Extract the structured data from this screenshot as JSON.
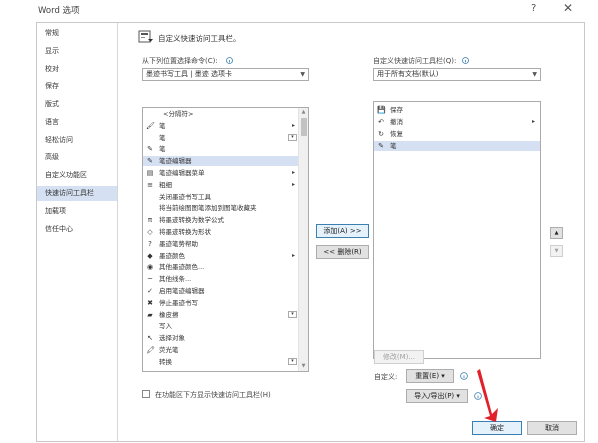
{
  "window": {
    "title": "Word 选项",
    "help_glyph": "?",
    "close_glyph": "✕"
  },
  "sidebar": {
    "items": [
      {
        "label": "常规"
      },
      {
        "label": "显示"
      },
      {
        "label": "校对"
      },
      {
        "label": "保存"
      },
      {
        "label": "版式"
      },
      {
        "label": "语言"
      },
      {
        "label": "轻松访问"
      },
      {
        "label": "高级"
      },
      {
        "label": "自定义功能区"
      },
      {
        "label": "快速访问工具栏",
        "active": true
      },
      {
        "label": "加载项"
      },
      {
        "label": "信任中心"
      }
    ]
  },
  "header": {
    "title": "自定义快速访问工具栏。",
    "icon": "quick-access-toolbar-icon"
  },
  "left_panel": {
    "label": "从下列位置选择命令(C):",
    "dropdown_value": "墨迹书写工具 | 墨迹 选项卡",
    "items": [
      {
        "label": "<分隔符>",
        "icon": "",
        "submenu": false,
        "mini": false
      },
      {
        "label": "笔",
        "icon": "🖌",
        "submenu": true,
        "mini": false
      },
      {
        "label": "笔",
        "icon": "",
        "submenu": false,
        "mini": true
      },
      {
        "label": "笔",
        "icon": "✎",
        "submenu": false,
        "mini": false
      },
      {
        "label": "笔迹编辑器",
        "icon": "✎",
        "submenu": false,
        "mini": false,
        "selected": true
      },
      {
        "label": "笔迹编辑器菜单",
        "icon": "▤",
        "submenu": true,
        "mini": false
      },
      {
        "label": "粗细",
        "icon": "≡",
        "submenu": true,
        "mini": false
      },
      {
        "label": "关闭墨迹书写工具",
        "icon": "",
        "submenu": false,
        "mini": false
      },
      {
        "label": "将当前绘图图笔添加到图笔收藏夹",
        "icon": "",
        "submenu": false,
        "mini": false
      },
      {
        "label": "将墨迹转换为数学公式",
        "icon": "π",
        "submenu": false,
        "mini": false
      },
      {
        "label": "将墨迹转换为形状",
        "icon": "◇",
        "submenu": false,
        "mini": false
      },
      {
        "label": "墨迹笔势帮助",
        "icon": "?",
        "submenu": false,
        "mini": false
      },
      {
        "label": "墨迹颜色",
        "icon": "◆",
        "submenu": true,
        "mini": false
      },
      {
        "label": "其他墨迹颜色...",
        "icon": "◉",
        "submenu": false,
        "mini": false
      },
      {
        "label": "其他线条...",
        "icon": "─",
        "submenu": false,
        "mini": false
      },
      {
        "label": "启用笔迹编辑器",
        "icon": "✓",
        "submenu": false,
        "mini": false
      },
      {
        "label": "停止墨迹书写",
        "icon": "✖",
        "submenu": false,
        "mini": false
      },
      {
        "label": "橡皮擦",
        "icon": "▰",
        "submenu": false,
        "mini": true
      },
      {
        "label": "写入",
        "icon": "",
        "submenu": false,
        "mini": false
      },
      {
        "label": "选择对象",
        "icon": "↖",
        "submenu": false,
        "mini": false
      },
      {
        "label": "荧光笔",
        "icon": "🖍",
        "submenu": false,
        "mini": false
      },
      {
        "label": "转换",
        "icon": "",
        "submenu": false,
        "mini": true
      }
    ],
    "checkbox_label": "在功能区下方显示快速访问工具栏(H)"
  },
  "middle": {
    "add_label": "添加(A) >>",
    "remove_label": "<< 删除(R)"
  },
  "right_panel": {
    "label": "自定义快速访问工具栏(Q):",
    "dropdown_value": "用于所有文档(默认)",
    "items": [
      {
        "label": "保存",
        "icon": "💾",
        "submenu": false
      },
      {
        "label": "撤消",
        "icon": "↶",
        "submenu": true
      },
      {
        "label": "恢复",
        "icon": "↻",
        "submenu": false
      },
      {
        "label": "笔",
        "icon": "✎",
        "submenu": false,
        "selected": true
      }
    ],
    "modify_label": "修改(M)...",
    "customize_label": "自定义:",
    "reset_label": "重置(E) ▾",
    "import_export_label": "导入/导出(P) ▾"
  },
  "footer": {
    "ok_label": "确定",
    "cancel_label": "取消"
  },
  "colors": {
    "accent": "#3c7fb1",
    "selection": "#d5e1f2",
    "sidebar_active": "#d5e1f2"
  }
}
